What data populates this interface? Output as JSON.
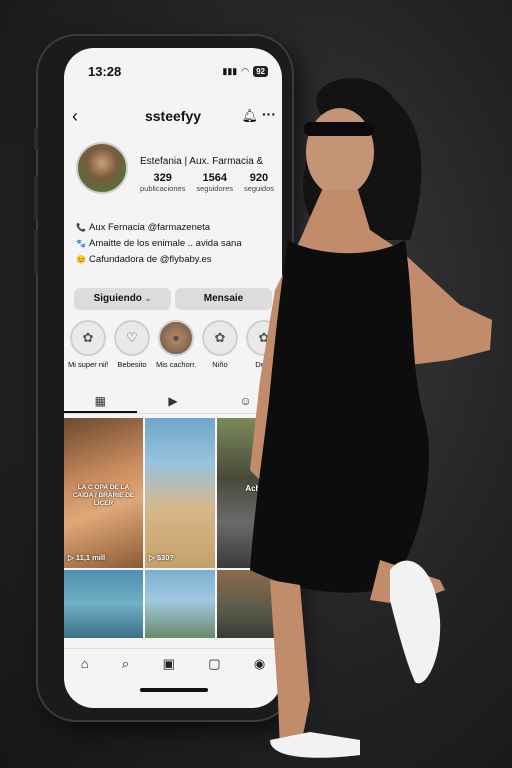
{
  "status": {
    "time": "13:28",
    "battery": "92"
  },
  "profile": {
    "username": "ssteefyy",
    "full_name": "Estefania | Aux. Farmacia &",
    "stats": [
      {
        "value": "329",
        "label": "publicaciones"
      },
      {
        "value": "1564",
        "label": "seguidores"
      },
      {
        "value": "920",
        "label": "seguidos"
      }
    ],
    "bio": [
      {
        "icon": "phone-icon",
        "glyph": "📞",
        "text": "Aux Fernacia @farmazeneta"
      },
      {
        "icon": "paw-icon",
        "glyph": "🐾",
        "text": "Amaitte de los enimale .. avida sana"
      },
      {
        "icon": "smile-icon",
        "glyph": "😊",
        "text": "Cafundadora de @flybaby.es"
      }
    ]
  },
  "actions": {
    "following": "Siguiendo",
    "message": "Mensaie"
  },
  "highlights": [
    {
      "label": "Mi super niño",
      "glyph": "✿"
    },
    {
      "label": "Bebesito",
      "glyph": "♡"
    },
    {
      "label": "Mis cachorr...",
      "glyph": "●"
    },
    {
      "label": "Niño",
      "glyph": "✿"
    },
    {
      "label": "Dese",
      "glyph": "✿"
    }
  ],
  "posts": [
    {
      "caption": "LA C OPA DE LA CAIDA / BRARIE DE LICER",
      "views": "11,1 mill"
    },
    {
      "caption": "",
      "views": "$30?"
    },
    {
      "caption": "Acho, que",
      "views": ""
    }
  ]
}
